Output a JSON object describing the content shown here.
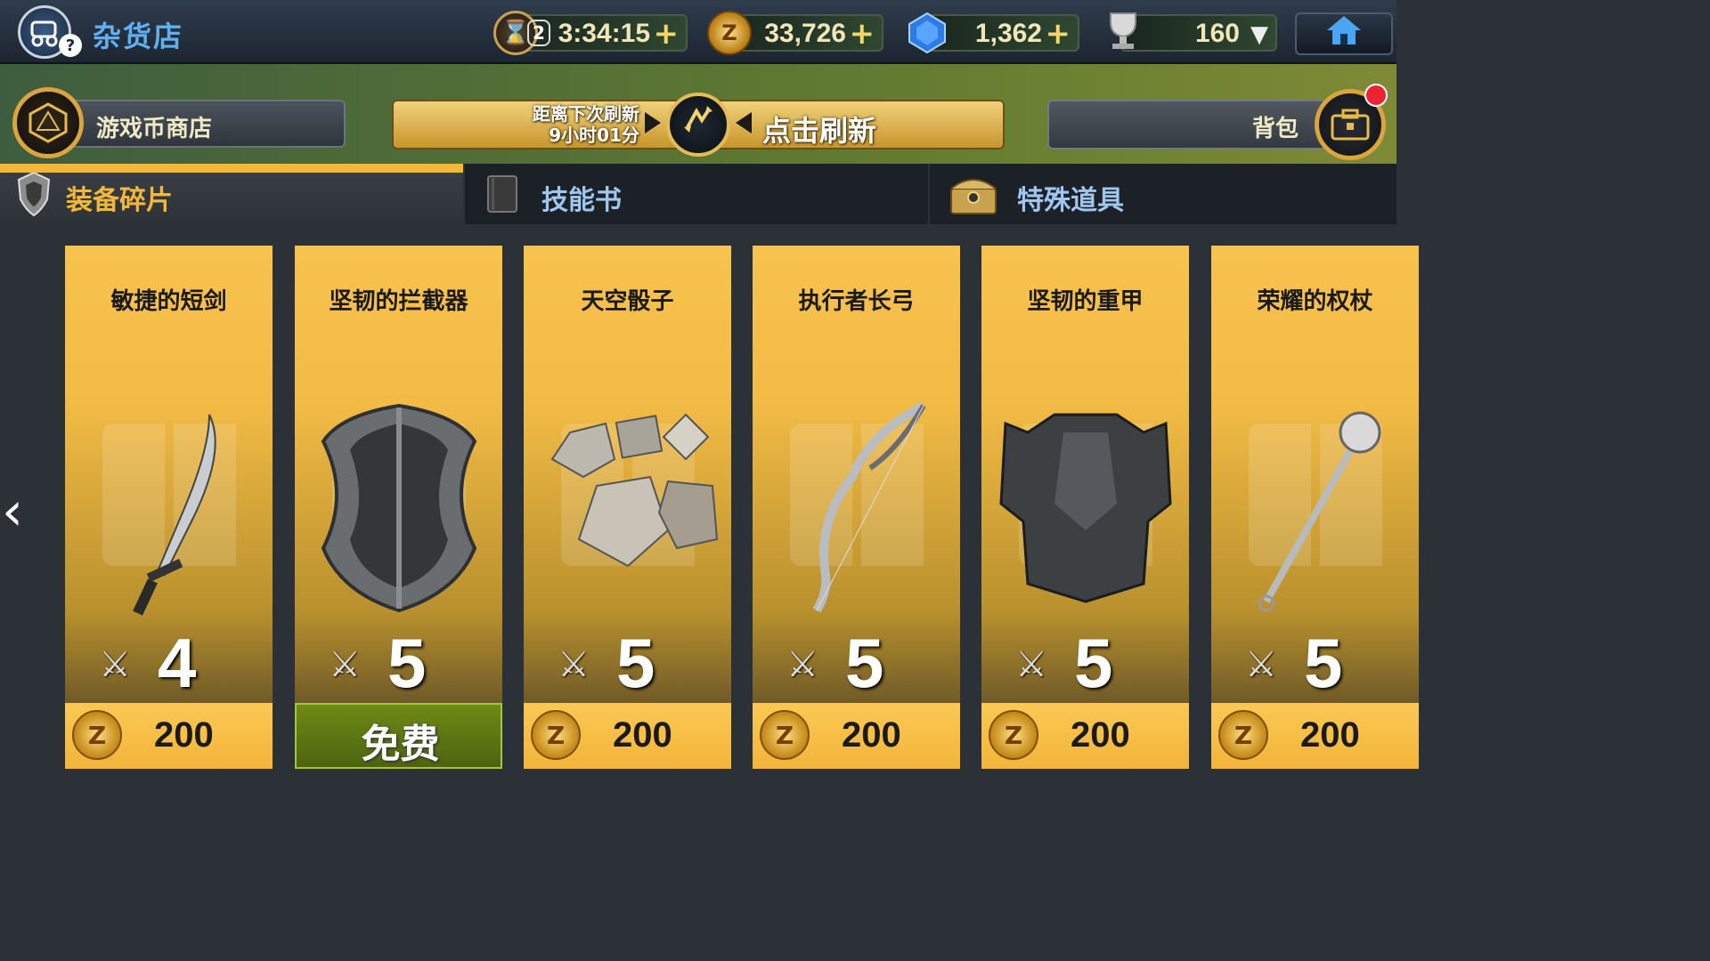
{
  "header": {
    "title": "杂货店",
    "shop_icon": "carriage-icon",
    "help_badge": "?",
    "timer": {
      "badge": "2",
      "value": "3:34:15",
      "plus": "+"
    },
    "gold": {
      "value": "33,726",
      "plus": "+"
    },
    "gems": {
      "value": "1,362",
      "plus": "+"
    },
    "trophy": {
      "value": "160",
      "caret": "▼"
    },
    "home_icon": "home-icon"
  },
  "subbar": {
    "coin_shop_label": "游戏币商店",
    "refresh_countdown_line1": "距离下次刷新",
    "refresh_countdown_line2": "9小时01分",
    "refresh_label": "点击刷新",
    "bag_label": "背包"
  },
  "tabs": [
    {
      "label": "装备碎片",
      "icon": "shield-crest-icon",
      "active": true
    },
    {
      "label": "技能书",
      "icon": "book-icon",
      "active": false
    },
    {
      "label": "特殊道具",
      "icon": "treasure-chest-icon",
      "active": false
    }
  ],
  "items": [
    {
      "name": "敏捷的短剑",
      "count": "4",
      "price": "200",
      "free": false,
      "art": "dagger"
    },
    {
      "name": "坚韧的拦截器",
      "count": "5",
      "price": "免费",
      "free": true,
      "art": "shield"
    },
    {
      "name": "天空骰子",
      "count": "5",
      "price": "200",
      "free": false,
      "art": "dice"
    },
    {
      "name": "执行者长弓",
      "count": "5",
      "price": "200",
      "free": false,
      "art": "bow"
    },
    {
      "name": "坚韧的重甲",
      "count": "5",
      "price": "200",
      "free": false,
      "art": "armor"
    },
    {
      "name": "荣耀的权杖",
      "count": "5",
      "price": "200",
      "free": false,
      "art": "scepter"
    }
  ],
  "nav": {
    "left_arrow": "‹",
    "right_arrow": "›"
  },
  "colors": {
    "accent_gold": "#f3b73a",
    "title_blue": "#5fb0f0",
    "free_green": "#5c7414"
  }
}
